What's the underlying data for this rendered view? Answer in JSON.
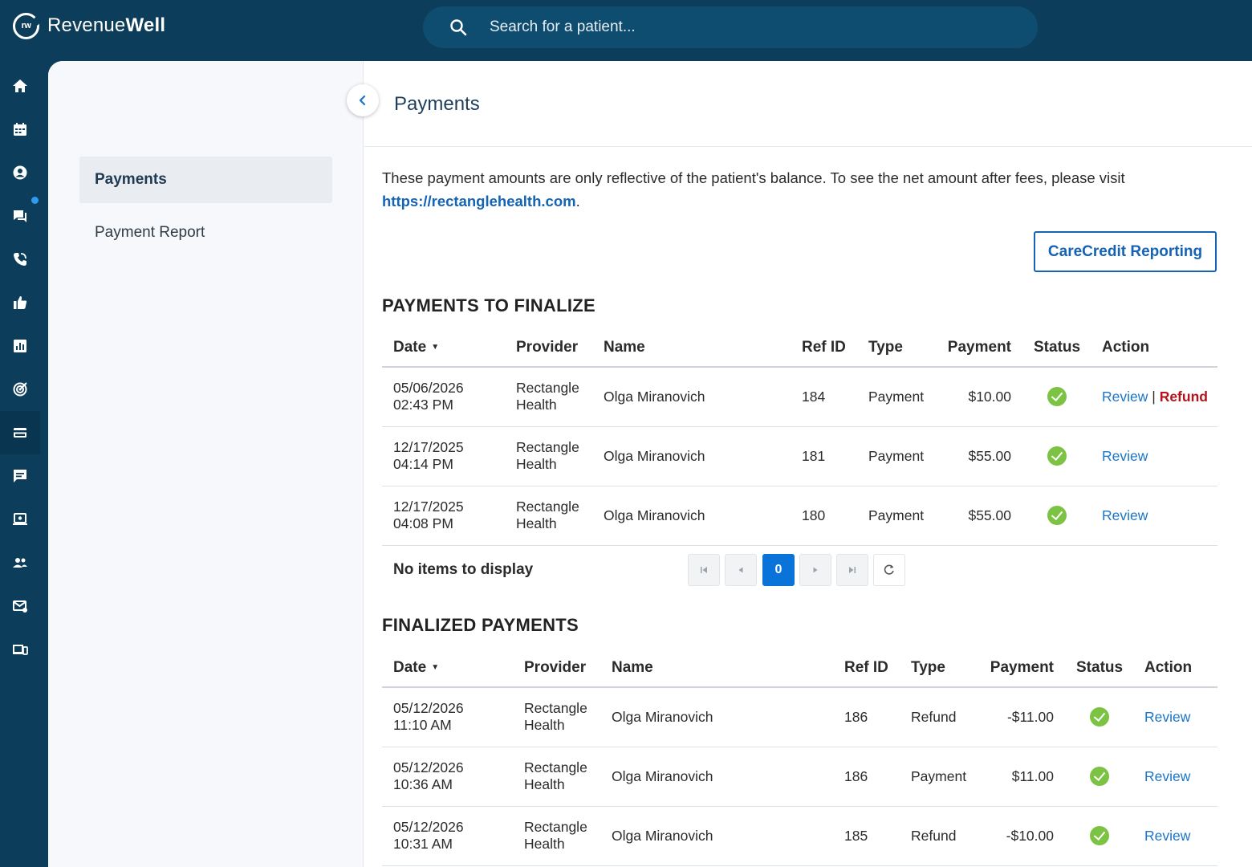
{
  "app": {
    "logo_mark": "rw",
    "brand_regular": "Revenue",
    "brand_bold": "Well"
  },
  "search": {
    "placeholder": "Search for a patient..."
  },
  "rail": {
    "icons": [
      "home-icon",
      "calendar-icon",
      "patient-icon",
      "chat-icon",
      "phone-icon",
      "thumbs-up-icon",
      "analytics-icon",
      "target-icon",
      "payments-card-icon",
      "feedback-icon",
      "screen-icon",
      "team-icon",
      "mail-icon",
      "devices-icon"
    ],
    "active": "payments-card-icon",
    "notification_color": "#2f9bf0"
  },
  "subnav": {
    "items": [
      {
        "label": "Payments",
        "active": true
      },
      {
        "label": "Payment Report",
        "active": false
      }
    ]
  },
  "page": {
    "title": "Payments",
    "notice": "These payment amounts are only reflective of the patient's balance. To see the net amount after fees, please visit",
    "notice_link": "https://rectanglehealth.com",
    "notice_end": ".",
    "carecredit_button": "CareCredit Reporting"
  },
  "to_finalize": {
    "title": "PAYMENTS TO FINALIZE",
    "headers": {
      "date": "Date",
      "provider": "Provider",
      "name": "Name",
      "ref": "Ref ID",
      "type": "Type",
      "payment": "Payment",
      "status": "Status",
      "action": "Action"
    },
    "rows": [
      {
        "date": "05/06/2026",
        "time": "02:43 PM",
        "provider_1": "Rectangle",
        "provider_2": "Health",
        "name": "Olga Miranovich",
        "ref": "184",
        "type": "Payment",
        "payment": "$10.00",
        "status": "complete",
        "review": "Review",
        "sep": "|",
        "refund": "Refund"
      },
      {
        "date": "12/17/2025",
        "time": "04:14 PM",
        "provider_1": "Rectangle",
        "provider_2": "Health",
        "name": "Olga Miranovich",
        "ref": "181",
        "type": "Payment",
        "payment": "$55.00",
        "status": "complete",
        "review": "Review"
      },
      {
        "date": "12/17/2025",
        "time": "04:08 PM",
        "provider_1": "Rectangle",
        "provider_2": "Health",
        "name": "Olga Miranovich",
        "ref": "180",
        "type": "Payment",
        "payment": "$55.00",
        "status": "complete",
        "review": "Review"
      }
    ],
    "pager": {
      "empty_text": "No items to display",
      "current_page": "0"
    }
  },
  "finalized": {
    "title": "FINALIZED PAYMENTS",
    "headers": {
      "date": "Date",
      "provider": "Provider",
      "name": "Name",
      "ref": "Ref ID",
      "type": "Type",
      "payment": "Payment",
      "status": "Status",
      "action": "Action"
    },
    "rows": [
      {
        "date": "05/12/2026",
        "time": "11:10 AM",
        "provider_1": "Rectangle",
        "provider_2": "Health",
        "name": "Olga Miranovich",
        "ref": "186",
        "type": "Refund",
        "payment": "-$11.00",
        "status": "complete",
        "review": "Review"
      },
      {
        "date": "05/12/2026",
        "time": "10:36 AM",
        "provider_1": "Rectangle",
        "provider_2": "Health",
        "name": "Olga Miranovich",
        "ref": "186",
        "type": "Payment",
        "payment": "$11.00",
        "status": "complete",
        "review": "Review"
      },
      {
        "date": "05/12/2026",
        "time": "10:31 AM",
        "provider_1": "Rectangle",
        "provider_2": "Health",
        "name": "Olga Miranovich",
        "ref": "185",
        "type": "Refund",
        "payment": "-$10.00",
        "status": "complete",
        "review": "Review"
      }
    ]
  },
  "colors": {
    "brand_navy": "#0c3d5a",
    "link_blue": "#1a74c7",
    "primary_blue": "#0a73d9",
    "refund_red": "#b3141c",
    "status_green": "#7cc243"
  }
}
